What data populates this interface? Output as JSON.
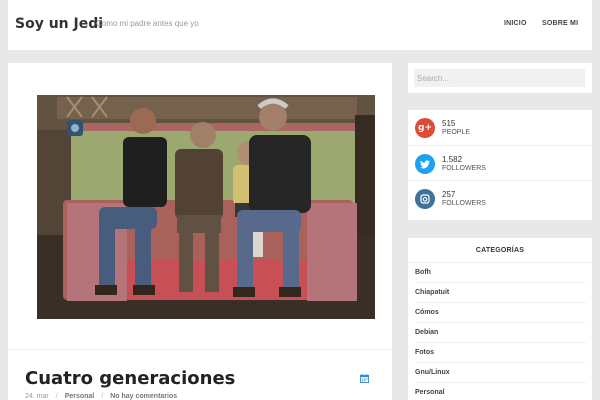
{
  "header": {
    "site_title": "Soy un Jedi",
    "tagline": "Como mi padre antes que yo",
    "nav": [
      {
        "label": "INICIO"
      },
      {
        "label": "SOBRE MI"
      }
    ]
  },
  "post": {
    "title": "Cuatro generaciones",
    "date": "24. mar",
    "category": "Personal",
    "comments": "No hay comentarios",
    "separator": "/",
    "image_icon": "family-photo",
    "date_icon": "calendar-icon"
  },
  "search": {
    "placeholder": "Search..."
  },
  "social": [
    {
      "network": "google-plus",
      "icon": "google-plus-icon",
      "glyph": "g+",
      "count": "515",
      "label": "PEOPLE",
      "color": "#dd4b39"
    },
    {
      "network": "twitter",
      "icon": "twitter-icon",
      "glyph": "t",
      "count": "1.582",
      "label": "FOLLOWERS",
      "color": "#1da1f2"
    },
    {
      "network": "instagram",
      "icon": "instagram-icon",
      "glyph": "◙",
      "count": "257",
      "label": "FOLLOWERS",
      "color": "#3f729b"
    }
  ],
  "categories": {
    "title": "CATEGORÍAS",
    "items": [
      "Bofh",
      "Chiapatuit",
      "Cómos",
      "Debian",
      "Fotos",
      "Gnu/Linux",
      "Personal"
    ]
  },
  "colors": {
    "page_background": "#e8e8e8",
    "accent_blue": "#3a87c9"
  }
}
